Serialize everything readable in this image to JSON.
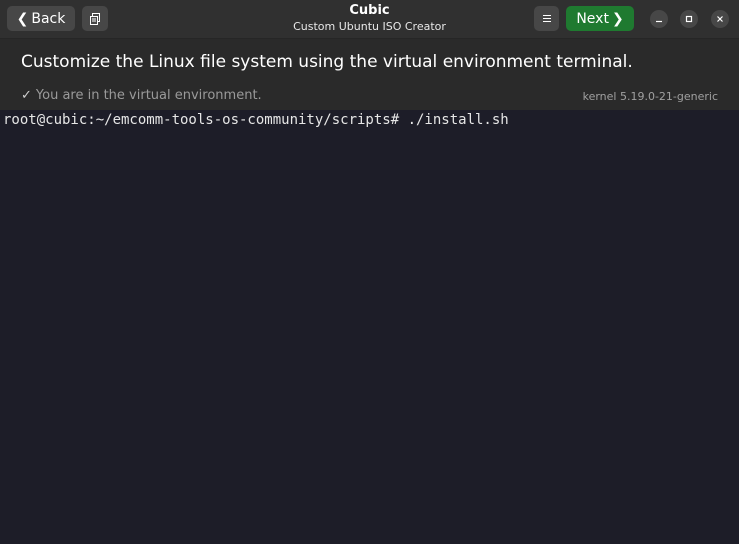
{
  "titlebar": {
    "back_label": "Back",
    "title": "Cubic",
    "subtitle": "Custom Ubuntu ISO Creator",
    "next_label": "Next"
  },
  "header": {
    "title": "Customize the Linux file system using the virtual environment terminal.",
    "status": "You are in the virtual environment.",
    "kernel": "kernel 5.19.0-21-generic"
  },
  "terminal": {
    "line": "root@cubic:~/emcomm-tools-os-community/scripts# ./install.sh"
  },
  "colors": {
    "next_button": "#1f7a30",
    "terminal_bg": "#1d1d28"
  },
  "icons": [
    "chevron-left-icon",
    "copy-icon",
    "menu-icon",
    "chevron-right-icon",
    "minimize-icon",
    "maximize-icon",
    "close-icon",
    "check-icon"
  ]
}
